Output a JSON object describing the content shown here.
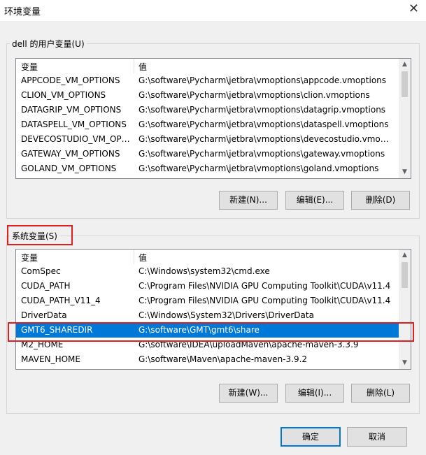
{
  "window": {
    "title": "环境变量",
    "close_glyph": "✕"
  },
  "user_group": {
    "label": "dell 的用户变量(U)",
    "columns": [
      "变量",
      "值"
    ],
    "rows": [
      {
        "name": "APPCODE_VM_OPTIONS",
        "value": "G:\\software\\Pycharm\\jetbra\\vmoptions\\appcode.vmoptions"
      },
      {
        "name": "CLION_VM_OPTIONS",
        "value": "G:\\software\\Pycharm\\jetbra\\vmoptions\\clion.vmoptions"
      },
      {
        "name": "DATAGRIP_VM_OPTIONS",
        "value": "G:\\software\\Pycharm\\jetbra\\vmoptions\\datagrip.vmoptions"
      },
      {
        "name": "DATASPELL_VM_OPTIONS",
        "value": "G:\\software\\Pycharm\\jetbra\\vmoptions\\dataspell.vmoptions"
      },
      {
        "name": "DEVECOSTUDIO_VM_OPT...",
        "value": "G:\\software\\Pycharm\\jetbra\\vmoptions\\devecostudio.vmopti..."
      },
      {
        "name": "GATEWAY_VM_OPTIONS",
        "value": "G:\\software\\Pycharm\\jetbra\\vmoptions\\gateway.vmoptions"
      },
      {
        "name": "GOLAND_VM_OPTIONS",
        "value": "G:\\software\\Pycharm\\jetbra\\vmoptions\\goland.vmoptions"
      }
    ],
    "buttons": {
      "new": "新建(N)...",
      "edit": "编辑(E)...",
      "delete": "删除(D)"
    }
  },
  "system_group": {
    "label": "系统变量(S)",
    "columns": [
      "变量",
      "值"
    ],
    "rows": [
      {
        "name": "ComSpec",
        "value": "C:\\Windows\\system32\\cmd.exe",
        "selected": false
      },
      {
        "name": "CUDA_PATH",
        "value": "C:\\Program Files\\NVIDIA GPU Computing Toolkit\\CUDA\\v11.4",
        "selected": false
      },
      {
        "name": "CUDA_PATH_V11_4",
        "value": "C:\\Program Files\\NVIDIA GPU Computing Toolkit\\CUDA\\v11.4",
        "selected": false
      },
      {
        "name": "DriverData",
        "value": "C:\\Windows\\System32\\Drivers\\DriverData",
        "selected": false
      },
      {
        "name": "GMT6_SHAREDIR",
        "value": "G:\\software\\GMT\\gmt6\\share",
        "selected": true
      },
      {
        "name": "M2_HOME",
        "value": "G:\\software\\IDEA\\uploadMaven\\apache-maven-3.3.9",
        "selected": false
      },
      {
        "name": "MAVEN_HOME",
        "value": "G:\\software\\Maven\\apache-maven-3.9.2",
        "selected": false
      }
    ],
    "buttons": {
      "new": "新建(W)...",
      "edit": "编辑(I)...",
      "delete": "删除(L)"
    }
  },
  "footer": {
    "ok": "确定",
    "cancel": "取消"
  },
  "colors": {
    "selection": "#0078d7",
    "highlight_box": "#e02020"
  }
}
